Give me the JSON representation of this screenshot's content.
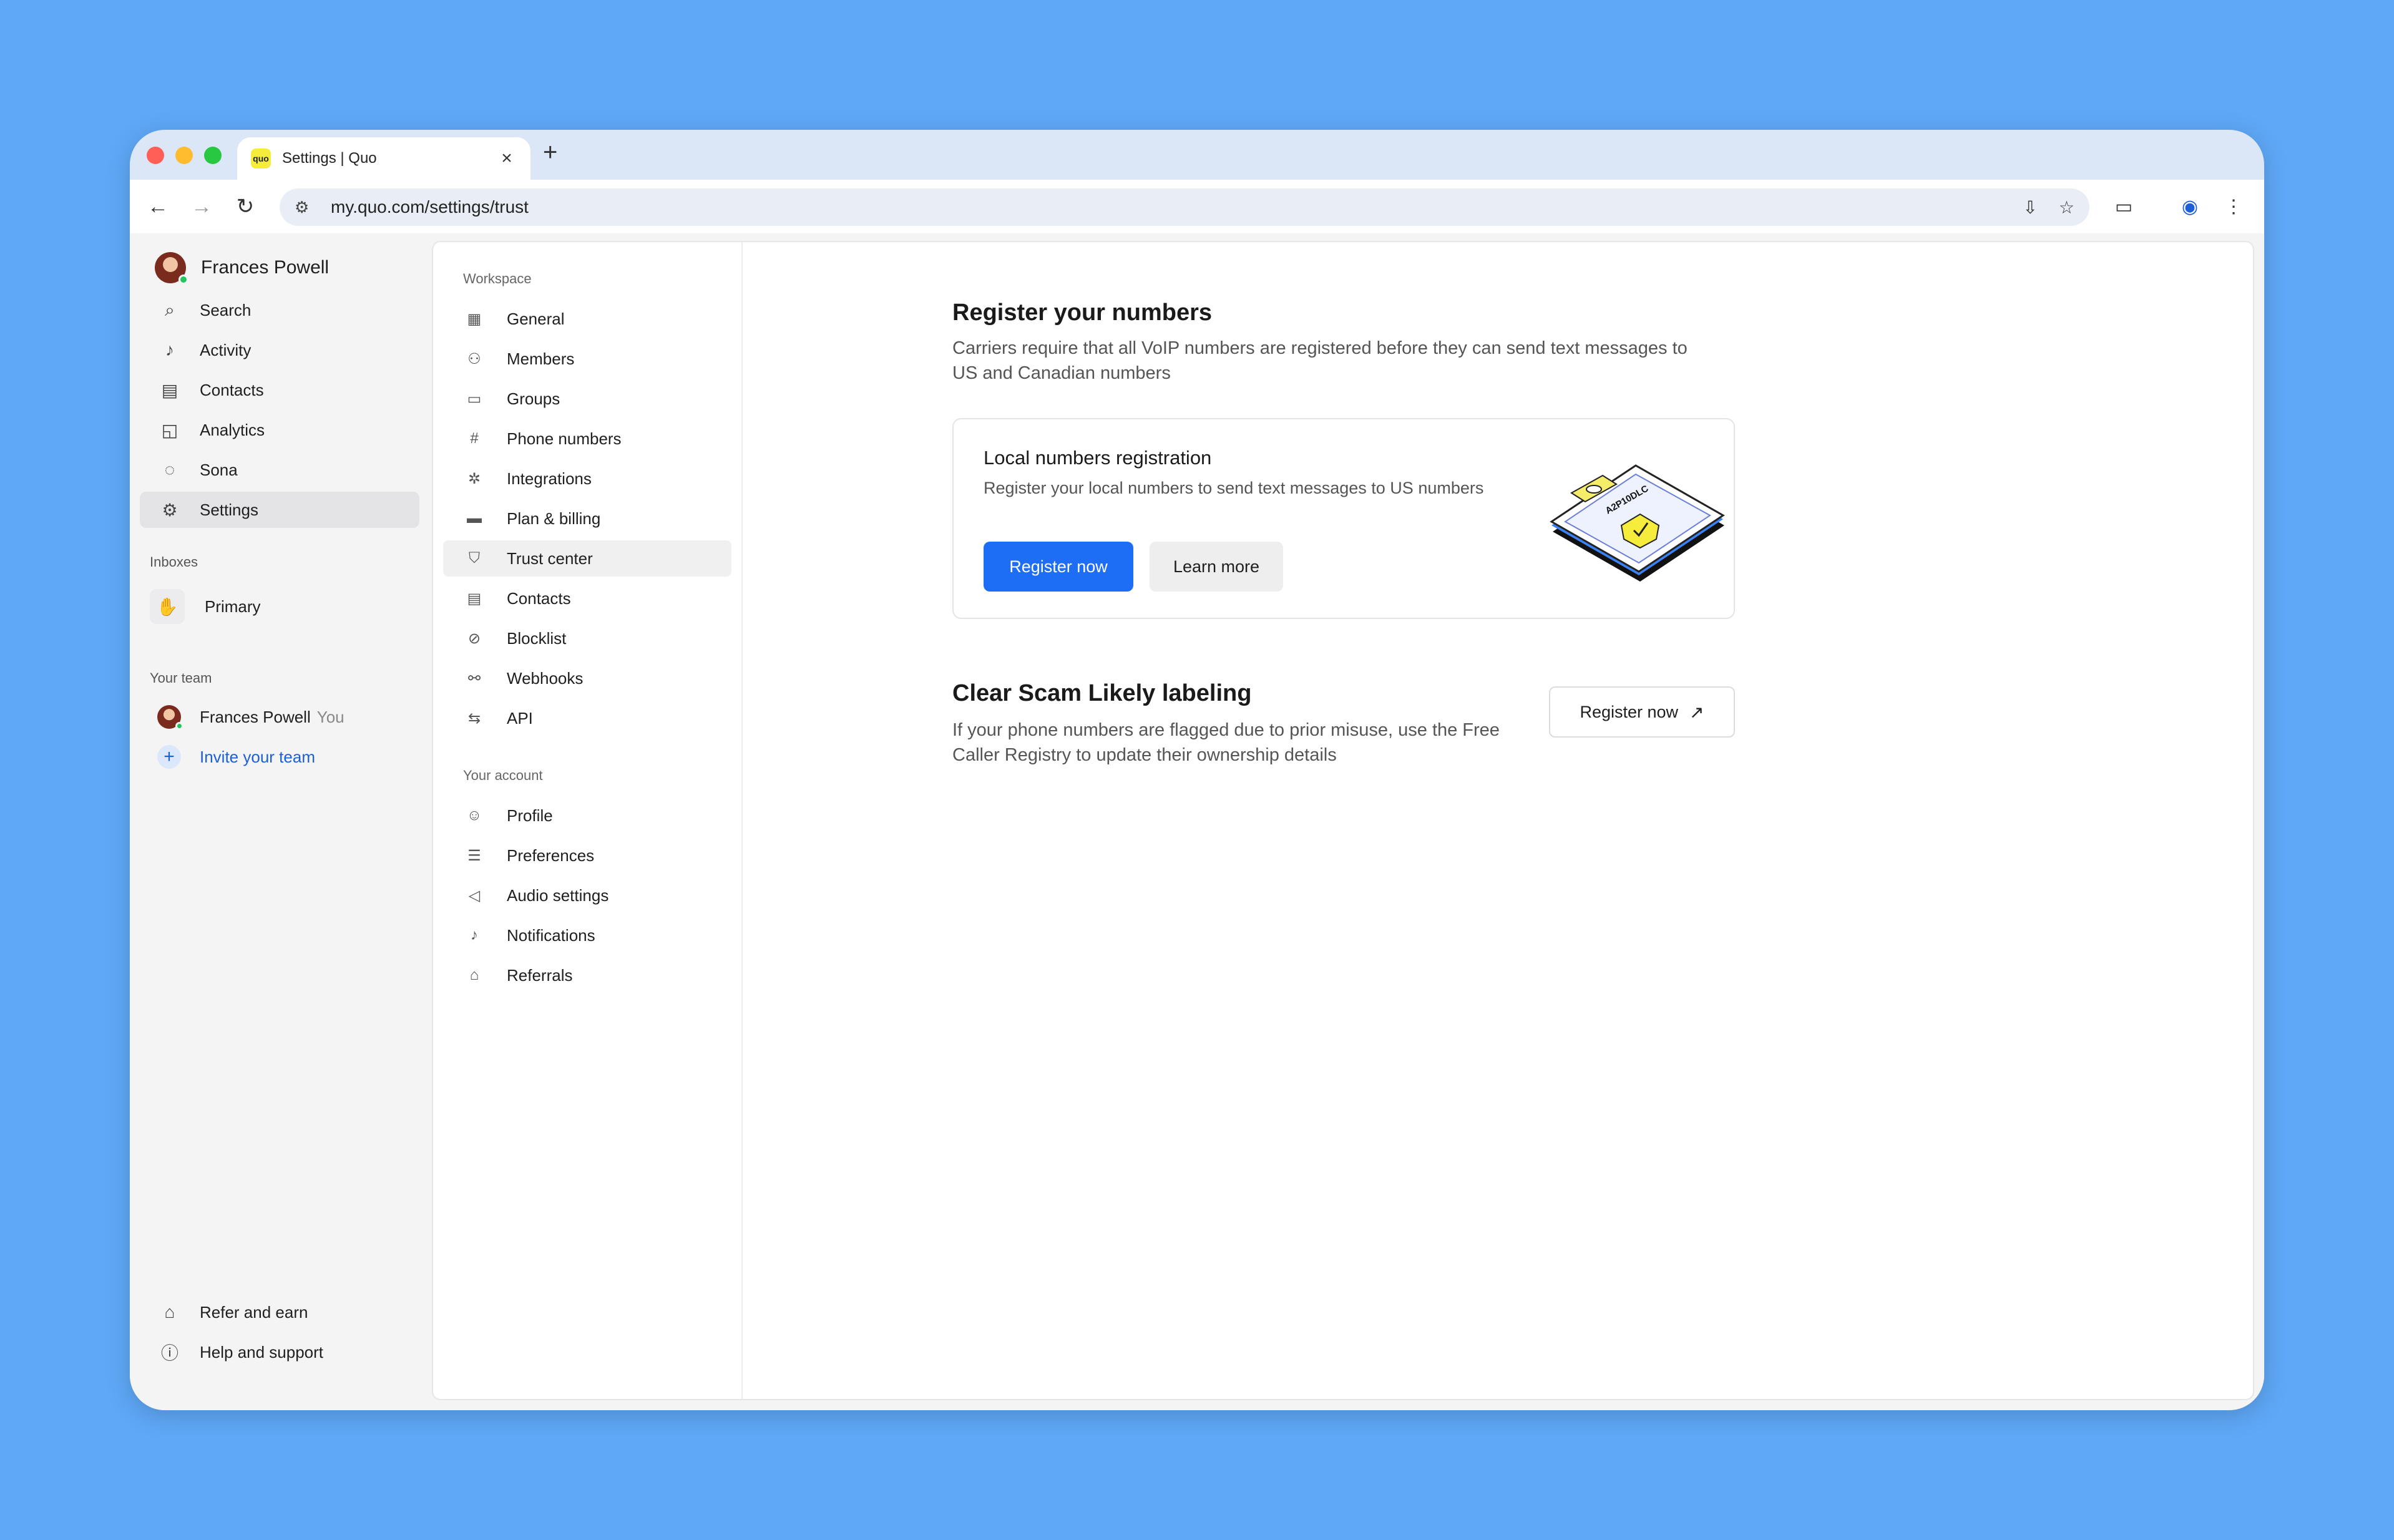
{
  "browser": {
    "tab_title": "Settings | Quo",
    "favicon_text": "quo",
    "url": "my.quo.com/settings/trust"
  },
  "rail": {
    "user_name": "Frances Powell",
    "items": [
      {
        "label": "Search",
        "icon": "search-icon"
      },
      {
        "label": "Activity",
        "icon": "bell-icon"
      },
      {
        "label": "Contacts",
        "icon": "contacts-icon"
      },
      {
        "label": "Analytics",
        "icon": "analytics-icon"
      },
      {
        "label": "Sona",
        "icon": "sona-icon"
      },
      {
        "label": "Settings",
        "icon": "gear-icon"
      }
    ],
    "inboxes_heading": "Inboxes",
    "inbox_name": "Primary",
    "team_heading": "Your team",
    "team_member_name": "Frances Powell",
    "team_member_you": "You",
    "invite_label": "Invite your team",
    "refer_label": "Refer and earn",
    "help_label": "Help and support"
  },
  "settings_nav": {
    "workspace_heading": "Workspace",
    "workspace_items": [
      {
        "label": "General"
      },
      {
        "label": "Members"
      },
      {
        "label": "Groups"
      },
      {
        "label": "Phone numbers"
      },
      {
        "label": "Integrations"
      },
      {
        "label": "Plan & billing"
      },
      {
        "label": "Trust center"
      },
      {
        "label": "Contacts"
      },
      {
        "label": "Blocklist"
      },
      {
        "label": "Webhooks"
      },
      {
        "label": "API"
      }
    ],
    "account_heading": "Your account",
    "account_items": [
      {
        "label": "Profile"
      },
      {
        "label": "Preferences"
      },
      {
        "label": "Audio settings"
      },
      {
        "label": "Notifications"
      },
      {
        "label": "Referrals"
      }
    ]
  },
  "main": {
    "title": "Register your numbers",
    "subtitle": "Carriers require that all VoIP numbers are registered before they can send text messages to US and Canadian numbers",
    "card": {
      "title": "Local numbers registration",
      "description": "Register your local numbers to send text messages to US numbers",
      "primary_button": "Register now",
      "secondary_button": "Learn more",
      "illustration_text": "A2P10DLC"
    },
    "scam": {
      "title": "Clear Scam Likely labeling",
      "description": "If your phone numbers are flagged due to prior misuse, use the Free Caller Registry to update their ownership details",
      "button": "Register now"
    }
  }
}
